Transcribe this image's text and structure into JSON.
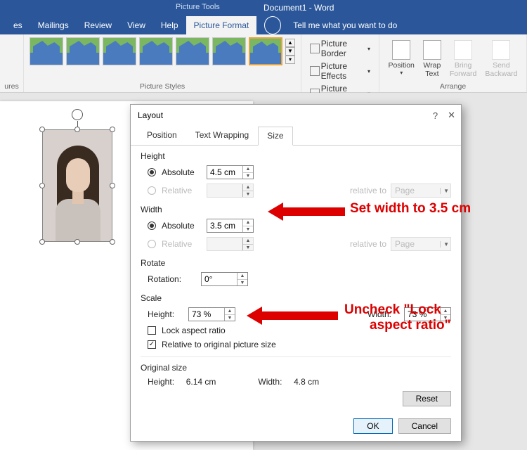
{
  "titlebar": {
    "doc": "Document1 - Word",
    "pic_tools": "Picture Tools"
  },
  "tabs": {
    "items": [
      "es",
      "Mailings",
      "Review",
      "View",
      "Help",
      "Picture Format"
    ],
    "tell_me": "Tell me what you want to do"
  },
  "ribbon": {
    "ures_group": "ures",
    "styles_label": "Picture Styles",
    "picture_border": "Picture Border",
    "picture_effects": "Picture Effects",
    "picture_layout": "Picture Layout",
    "position": "Position",
    "wrap_text": "Wrap\nText",
    "bring_forward": "Bring\nForward",
    "send_backward": "Send\nBackward",
    "arrange_label": "Arrange"
  },
  "dialog": {
    "title": "Layout",
    "help": "?",
    "close": "✕",
    "tabs": {
      "position": "Position",
      "text_wrapping": "Text Wrapping",
      "size": "Size"
    },
    "height_section": "Height",
    "width_section": "Width",
    "rotate_section": "Rotate",
    "scale_section": "Scale",
    "original_section": "Original size",
    "absolute": "Absolute",
    "relative": "Relative",
    "relative_to": "relative to",
    "page": "Page",
    "rotation": "Rotation:",
    "height_label": "Height:",
    "width_label": "Width:",
    "lock_aspect": "Lock aspect ratio",
    "rel_orig": "Relative to original picture size",
    "height_abs_val": "4.5 cm",
    "width_abs_val": "3.5 cm",
    "rotation_val": "0°",
    "scale_h": "73 %",
    "scale_w": "73 %",
    "orig_h": "6.14 cm",
    "orig_w": "4.8 cm",
    "reset": "Reset",
    "ok": "OK",
    "cancel": "Cancel"
  },
  "callouts": {
    "width": "Set width to 3.5 cm",
    "lock1": "Uncheck \"Lock",
    "lock2": "aspect ratio\""
  }
}
